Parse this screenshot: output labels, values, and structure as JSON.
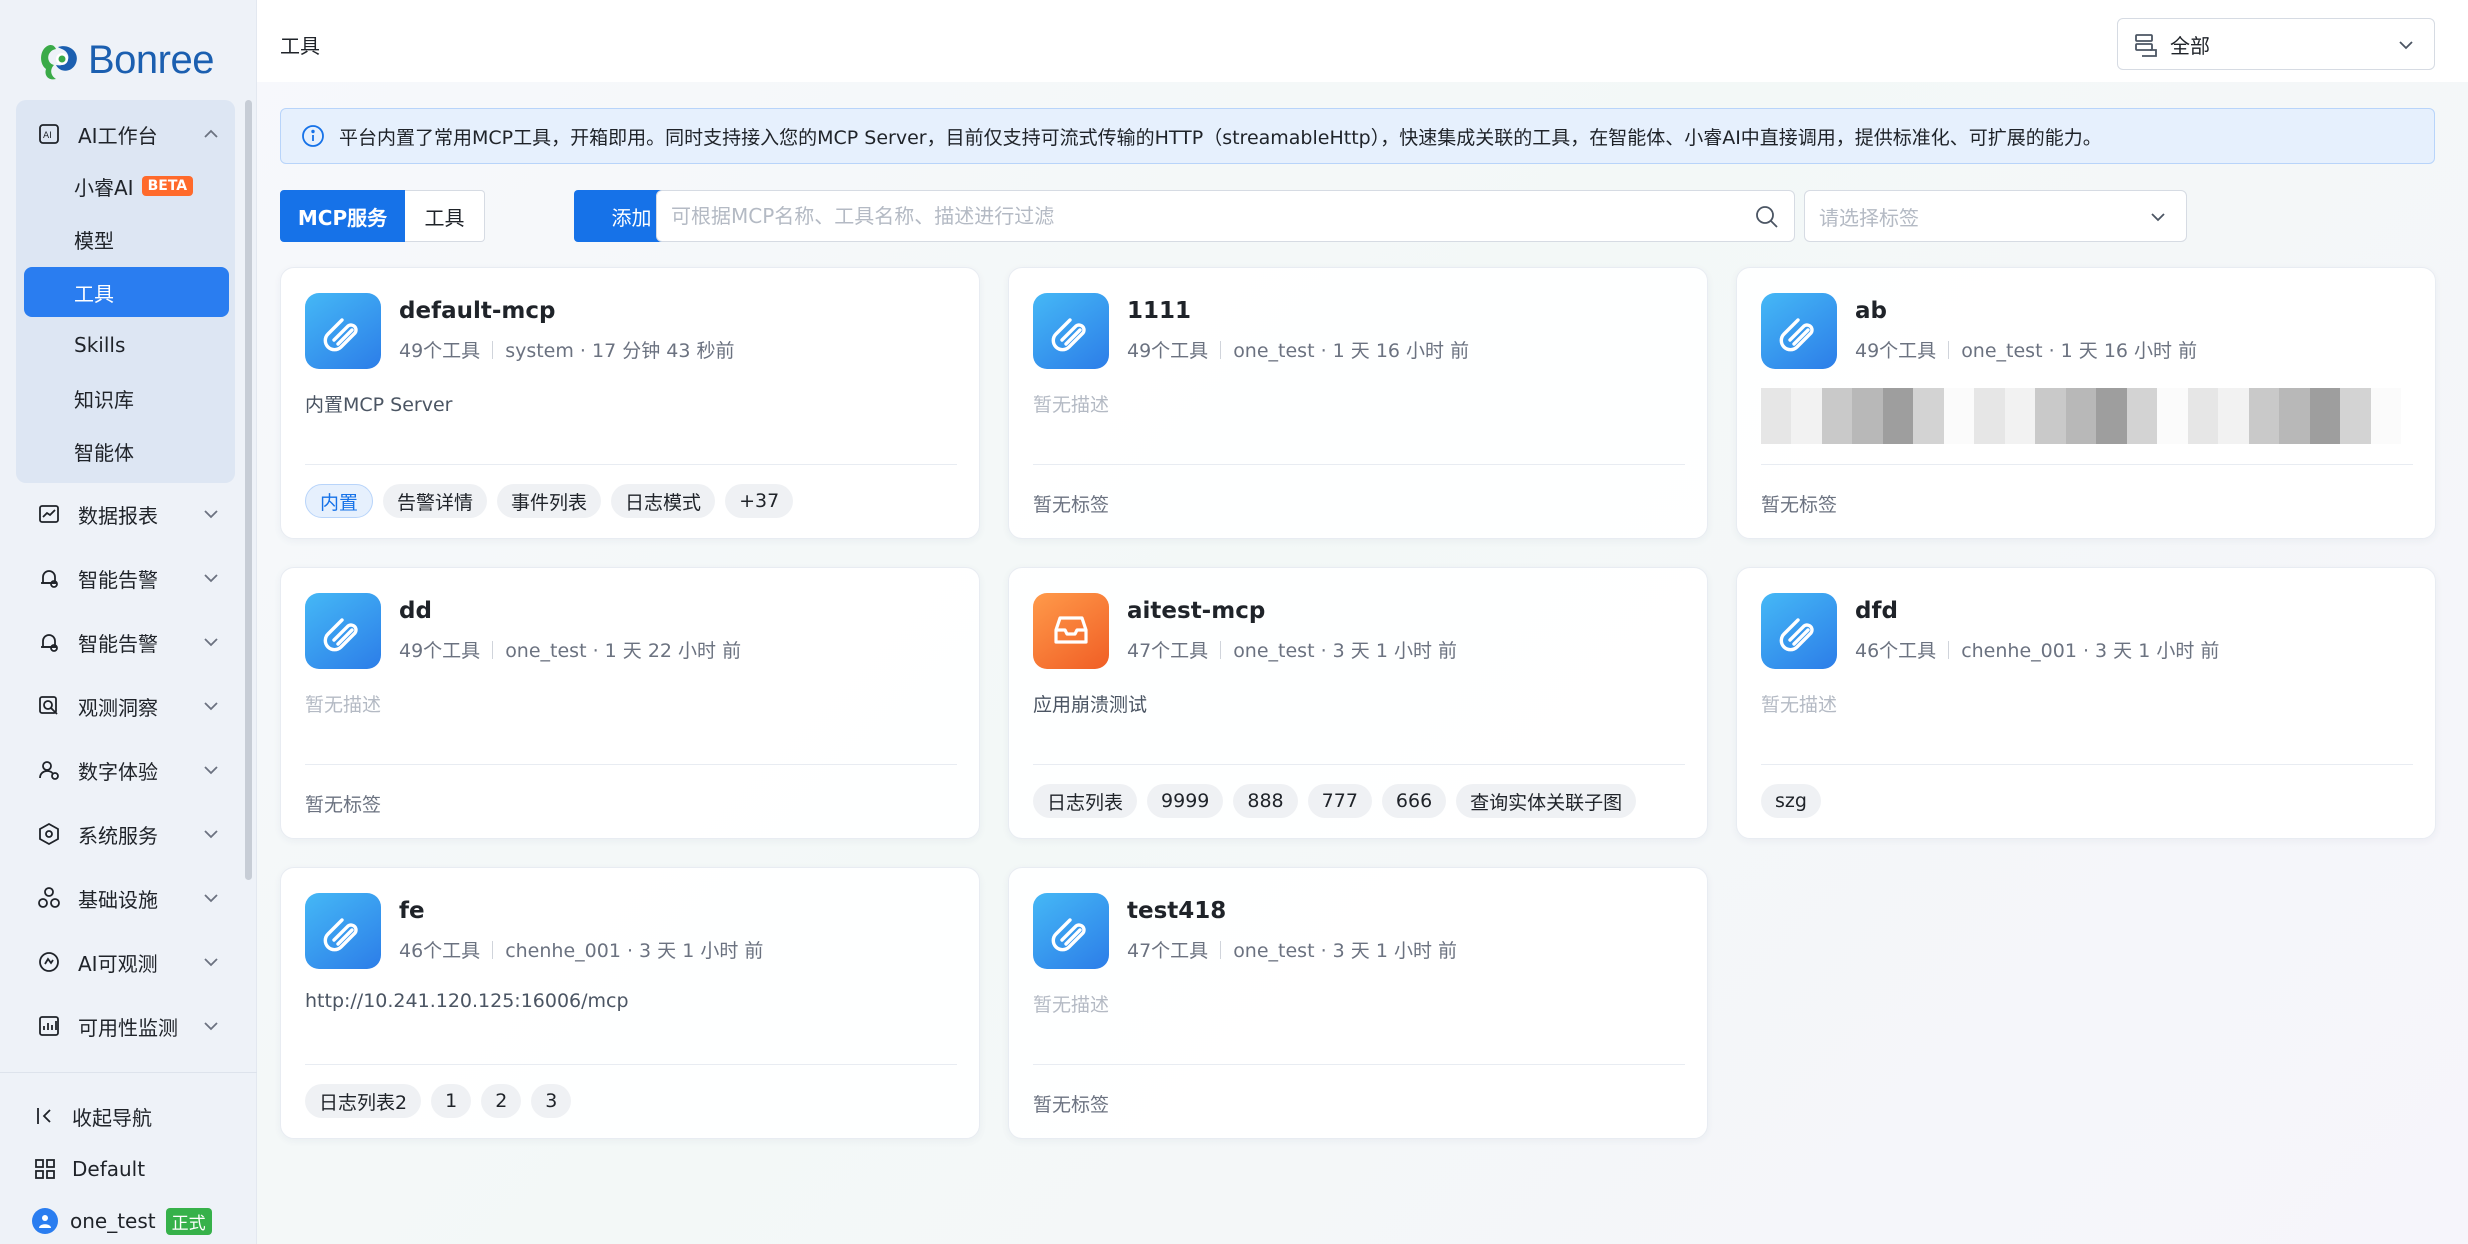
{
  "app": {
    "logo_text": "Bonree"
  },
  "sidebar": {
    "workspace": {
      "label": "AI工作台",
      "icon": "ai-workbench-icon"
    },
    "sub_items": [
      {
        "label": "小睿AI",
        "badge": "BETA",
        "active": false
      },
      {
        "label": "模型",
        "active": false
      },
      {
        "label": "工具",
        "active": true
      },
      {
        "label": "Skills",
        "active": false
      },
      {
        "label": "知识库",
        "active": false
      },
      {
        "label": "智能体",
        "active": false
      }
    ],
    "items": [
      {
        "label": "数据报表",
        "icon": "chart-report-icon"
      },
      {
        "label": "智能告警",
        "icon": "alert-icon"
      },
      {
        "label": "智能告警",
        "icon": "alert-icon"
      },
      {
        "label": "观测洞察",
        "icon": "insight-icon"
      },
      {
        "label": "数字体验",
        "icon": "user-experience-icon"
      },
      {
        "label": "系统服务",
        "icon": "system-service-icon"
      },
      {
        "label": "基础设施",
        "icon": "infrastructure-icon"
      },
      {
        "label": "AI可观测",
        "icon": "ai-observe-icon"
      },
      {
        "label": "可用性监测",
        "icon": "availability-icon"
      }
    ],
    "bottom": {
      "collapse_label": "收起导航",
      "workspace_label": "Default",
      "user_name": "one_test",
      "user_badge": "正式"
    }
  },
  "header": {
    "title": "工具",
    "scope_select": "全部"
  },
  "banner": {
    "text": "平台内置了常用MCP工具，开箱即用。同时支持接入您的MCP Server，目前仅支持可流式传输的HTTP（streamableHttp），快速集成关联的工具，在智能体、小睿AI中直接调用，提供标准化、可扩展的能力。"
  },
  "toolbar": {
    "tab_mcp": "MCP服务",
    "tab_tools": "工具",
    "add_label": "添加",
    "search_placeholder": "可根据MCP名称、工具名称、描述进行过滤",
    "tag_placeholder": "请选择标签"
  },
  "cards": [
    {
      "name": "default-mcp",
      "tools": "49个工具",
      "owner": "system · 17 分钟 43 秒前",
      "desc": "内置MCP Server",
      "desc_muted": false,
      "icon": "blue",
      "tags": [
        "内置",
        "告警详情",
        "事件列表",
        "日志模式",
        "+37"
      ],
      "no_tag": ""
    },
    {
      "name": "1111",
      "tools": "49个工具",
      "owner": "one_test · 1 天 16 小时 前",
      "desc": "暂无描述",
      "desc_muted": true,
      "icon": "blue",
      "tags": [],
      "no_tag": "暂无标签"
    },
    {
      "name": "ab",
      "tools": "49个工具",
      "owner": "one_test · 1 天 16 小时 前",
      "desc": "",
      "desc_muted": false,
      "icon": "blue",
      "tags": [],
      "no_tag": "暂无标签",
      "blurred": true
    },
    {
      "name": "dd",
      "tools": "49个工具",
      "owner": "one_test · 1 天 22 小时 前",
      "desc": "暂无描述",
      "desc_muted": true,
      "icon": "blue",
      "tags": [],
      "no_tag": "暂无标签"
    },
    {
      "name": "aitest-mcp",
      "tools": "47个工具",
      "owner": "one_test · 3 天 1 小时 前",
      "desc": "应用崩溃测试",
      "desc_muted": false,
      "icon": "orange",
      "tags": [
        "日志列表",
        "9999",
        "888",
        "777",
        "666",
        "查询实体关联子图"
      ],
      "no_tag": ""
    },
    {
      "name": "dfd",
      "tools": "46个工具",
      "owner": "chenhe_001 · 3 天 1 小时 前",
      "desc": "暂无描述",
      "desc_muted": true,
      "icon": "blue",
      "tags": [
        "szg"
      ],
      "no_tag": ""
    },
    {
      "name": "fe",
      "tools": "46个工具",
      "owner": "chenhe_001 · 3 天 1 小时 前",
      "desc": "http://10.241.120.125:16006/mcp",
      "desc_muted": false,
      "icon": "blue",
      "tags": [
        "日志列表2",
        "1",
        "2",
        "3"
      ],
      "no_tag": ""
    },
    {
      "name": "test418",
      "tools": "47个工具",
      "owner": "one_test · 3 天 1 小时 前",
      "desc": "暂无描述",
      "desc_muted": true,
      "icon": "blue",
      "tags": [],
      "no_tag": "暂无标签"
    }
  ],
  "colors": {
    "primary": "#1672e8",
    "active_nav": "#2a7df0",
    "beta_badge": "#ff6a2b",
    "env_badge": "#36b14a"
  }
}
